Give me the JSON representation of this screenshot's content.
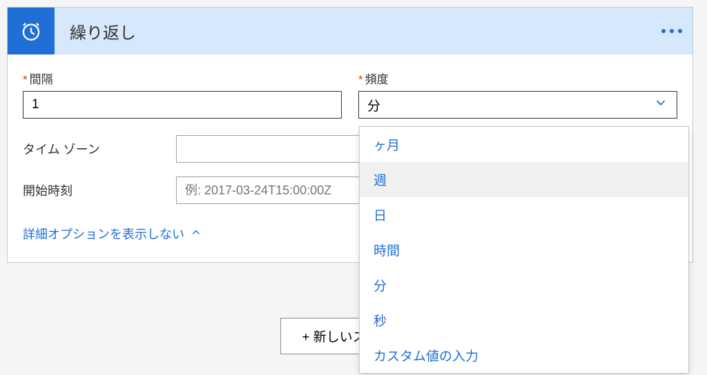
{
  "header": {
    "title": "繰り返し",
    "icon": "clock-icon"
  },
  "fields": {
    "interval": {
      "label": "間隔",
      "value": "1"
    },
    "frequency": {
      "label": "頻度",
      "value": "分"
    },
    "timezone": {
      "label": "タイム ゾーン",
      "value": ""
    },
    "startTime": {
      "label": "開始時刻",
      "placeholder": "例: 2017-03-24T15:00:00Z",
      "value": ""
    }
  },
  "advancedToggle": {
    "label": "詳細オプションを表示しない"
  },
  "dropdown": {
    "options": [
      "ヶ月",
      "週",
      "日",
      "時間",
      "分",
      "秒",
      "カスタム値の入力"
    ],
    "hoverIndex": 1
  },
  "newStep": {
    "label": "+ 新しいステップ"
  }
}
